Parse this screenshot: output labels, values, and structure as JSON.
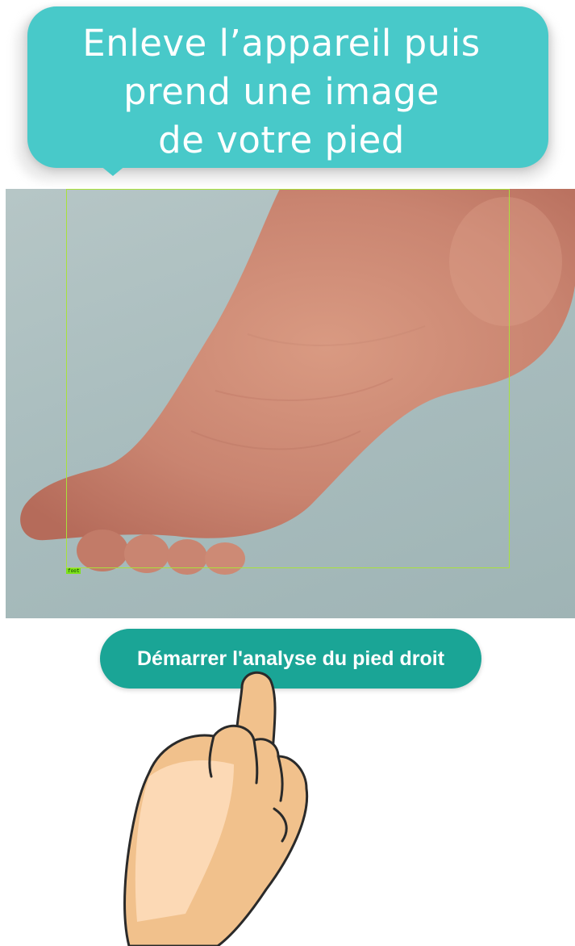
{
  "instruction": {
    "line1": "Enleve l’appareil puis",
    "line2": "prend une image",
    "line3": "de votre pied"
  },
  "camera": {
    "detection_label": "foot"
  },
  "start_button": {
    "label": "Démarrer l'analyse du pied droit"
  },
  "colors": {
    "bubble": "#48c9c9",
    "button": "#1aa596",
    "detection_box": "#a9e23a"
  }
}
